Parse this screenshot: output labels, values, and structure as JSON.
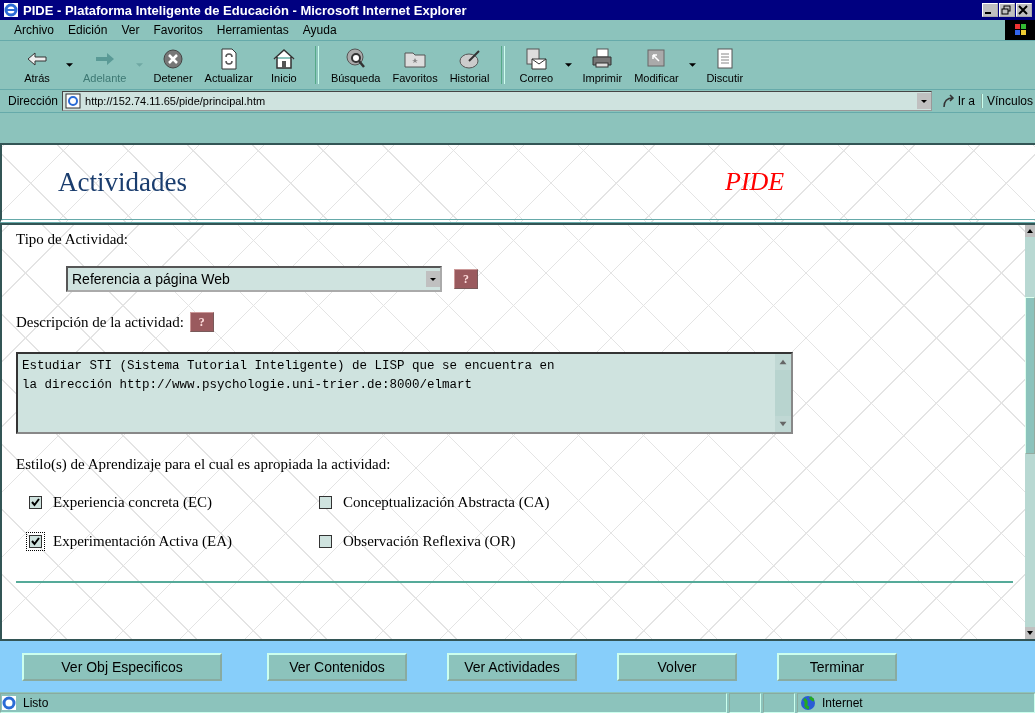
{
  "window": {
    "title": "PIDE - Plataforma Inteligente de Educación - Microsoft Internet Explorer"
  },
  "menu": [
    "Archivo",
    "Edición",
    "Ver",
    "Favoritos",
    "Herramientas",
    "Ayuda"
  ],
  "toolbar": {
    "groups": [
      [
        {
          "label": "Atrás",
          "disabled": false,
          "has_menu": true
        },
        {
          "label": "Adelante",
          "disabled": true,
          "has_menu": true
        },
        {
          "label": "Detener",
          "disabled": false,
          "has_menu": false
        },
        {
          "label": "Actualizar",
          "disabled": false,
          "has_menu": false
        },
        {
          "label": "Inicio",
          "disabled": false,
          "has_menu": false
        }
      ],
      [
        {
          "label": "Búsqueda",
          "disabled": false,
          "has_menu": false
        },
        {
          "label": "Favoritos",
          "disabled": false,
          "has_menu": false
        },
        {
          "label": "Historial",
          "disabled": false,
          "has_menu": false
        }
      ],
      [
        {
          "label": "Correo",
          "disabled": false,
          "has_menu": true
        },
        {
          "label": "Imprimir",
          "disabled": false,
          "has_menu": false
        },
        {
          "label": "Modificar",
          "disabled": false,
          "has_menu": true
        },
        {
          "label": "Discutir",
          "disabled": false,
          "has_menu": false
        }
      ]
    ]
  },
  "address": {
    "label": "Dirección",
    "value": "http://152.74.11.65/pide/principal.htm",
    "go": "Ir a",
    "links": "Vínculos"
  },
  "header": {
    "title": "Actividades",
    "brand": "PIDE"
  },
  "form": {
    "type_label": "Tipo de Actividad:",
    "type_value": "Referencia a página Web",
    "help": "?",
    "description_label": "Descripción de la actividad:",
    "description_help": "?",
    "description": "Estudiar STI (Sistema Tutorial Inteligente) de LISP que se encuentra en\nla dirección http://www.psychologie.uni-trier.de:8000/elmart",
    "styles_label": "Estilo(s) de Aprendizaje para el cual es apropiada la actividad:",
    "styles": [
      {
        "label": "Experiencia concreta (EC)",
        "checked": true,
        "focused": false
      },
      {
        "label": "Conceptualización Abstracta (CA)",
        "checked": false,
        "focused": false
      },
      {
        "label": "Experimentación Activa (EA)",
        "checked": true,
        "focused": true
      },
      {
        "label": "Observación Reflexiva (OR)",
        "checked": false,
        "focused": false
      }
    ]
  },
  "buttons": [
    "Ver Obj Especificos",
    "Ver Contenidos",
    "Ver Actividades",
    "Volver",
    "Terminar"
  ],
  "status_bar": {
    "text": "Listo",
    "zone": "Internet"
  }
}
